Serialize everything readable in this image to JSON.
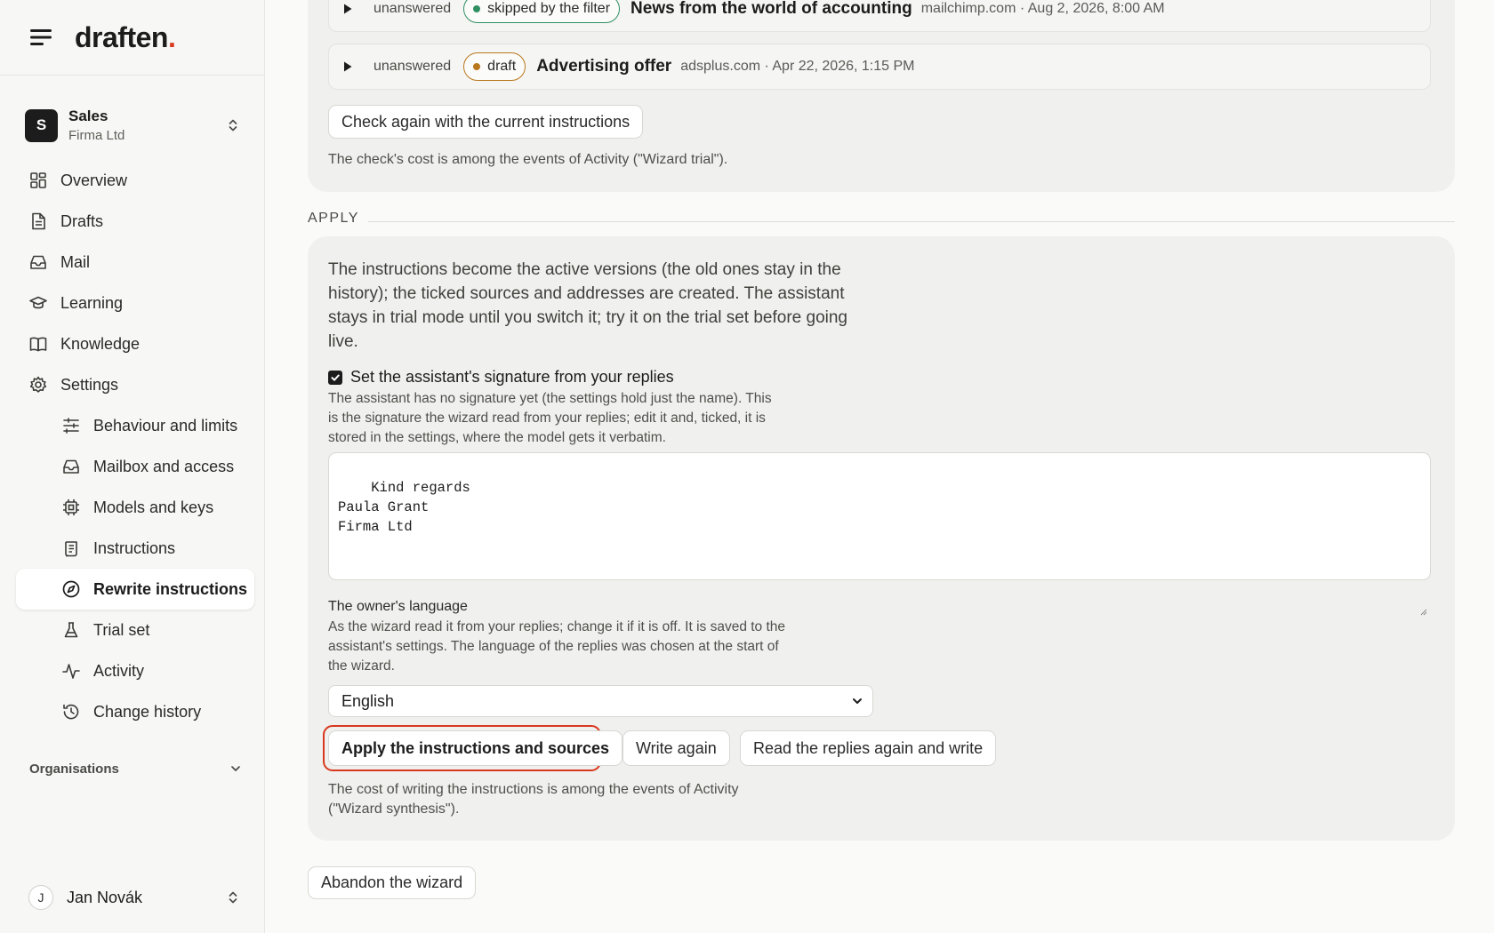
{
  "sidebar": {
    "logo_text": "draften",
    "logo_dot": ".",
    "org": {
      "initial": "S",
      "name": "Sales",
      "company": "Firma Ltd"
    },
    "nav": [
      {
        "label": "Overview",
        "icon": "grid-icon"
      },
      {
        "label": "Drafts",
        "icon": "document-icon"
      },
      {
        "label": "Mail",
        "icon": "inbox-icon"
      },
      {
        "label": "Learning",
        "icon": "graduation-cap-icon"
      },
      {
        "label": "Knowledge",
        "icon": "book-icon"
      },
      {
        "label": "Settings",
        "icon": "gear-icon"
      }
    ],
    "settings_sub": [
      {
        "label": "Behaviour and limits",
        "icon": "sliders-icon"
      },
      {
        "label": "Mailbox and access",
        "icon": "inbox-icon"
      },
      {
        "label": "Models and keys",
        "icon": "chip-icon"
      },
      {
        "label": "Instructions",
        "icon": "scroll-icon"
      },
      {
        "label": "Rewrite instructions",
        "icon": "compass-icon",
        "active": true
      },
      {
        "label": "Trial set",
        "icon": "flask-icon"
      },
      {
        "label": "Activity",
        "icon": "pulse-icon"
      },
      {
        "label": "Change history",
        "icon": "history-icon"
      }
    ],
    "organisations_label": "Organisations",
    "user": {
      "initial": "J",
      "name": "Jan Novák"
    }
  },
  "trial": {
    "rows": [
      {
        "status": "unanswered",
        "badge": "skipped by the filter",
        "badge_color": "#2f8f63",
        "subject": "News from the world of accounting",
        "meta": "mailchimp.com · Aug 2, 2026, 8:00 AM"
      },
      {
        "status": "unanswered",
        "badge": "draft",
        "badge_color": "#b9771b",
        "subject": "Advertising offer",
        "meta": "adsplus.com · Apr 22, 2026, 1:15 PM"
      }
    ],
    "check_again_label": "Check again with the current instructions",
    "cost_note": "The check's cost is among the events of Activity (\"Wizard trial\")."
  },
  "apply": {
    "section_label": "APPLY",
    "description": "The instructions become the active versions (the old ones stay in the history); the ticked sources and addresses are created. The assistant stays in trial mode until you switch it; try it on the trial set before going live.",
    "signature_checkbox_label": "Set the assistant's signature from your replies",
    "signature_checked": true,
    "signature_help": "The assistant has no signature yet (the settings hold just the name). This is the signature the wizard read from your replies; edit it and, ticked, it is stored in the settings, where the model gets it verbatim.",
    "signature_value": "Kind regards\nPaula Grant\nFirma Ltd",
    "language_label": "The owner's language",
    "language_help": "As the wizard read it from your replies; change it if it is off. It is saved to the assistant's settings. The language of the replies was chosen at the start of the wizard.",
    "language_value": "English",
    "apply_button": "Apply the instructions and sources",
    "write_again_button": "Write again",
    "read_again_button": "Read the replies again and write",
    "cost_note": "The cost of writing the instructions is among the events of Activity (\"Wizard synthesis\")."
  },
  "abandon_button": "Abandon the wizard",
  "colors": {
    "accent": "#d9381e",
    "ok": "#2f8f63",
    "warn": "#b9771b"
  }
}
